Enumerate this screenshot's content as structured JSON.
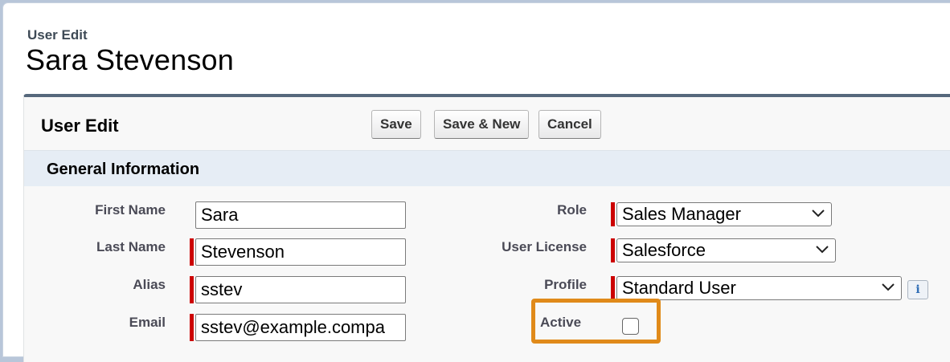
{
  "header": {
    "object_type": "User Edit",
    "record_name": "Sara Stevenson"
  },
  "block": {
    "title": "User Edit",
    "buttons": {
      "save": "Save",
      "save_new": "Save & New",
      "cancel": "Cancel"
    }
  },
  "section": {
    "title": "General Information"
  },
  "fields_left": {
    "first_name": {
      "label": "First Name",
      "value": "Sara"
    },
    "last_name": {
      "label": "Last Name",
      "value": "Stevenson"
    },
    "alias": {
      "label": "Alias",
      "value": "sstev"
    },
    "email": {
      "label": "Email",
      "value": "sstev@example.compa"
    }
  },
  "fields_right": {
    "role": {
      "label": "Role",
      "value": "Sales Manager"
    },
    "user_license": {
      "label": "User License",
      "value": "Salesforce"
    },
    "profile": {
      "label": "Profile",
      "value": "Standard User",
      "info_icon": "info-icon",
      "info_glyph": "i"
    },
    "active": {
      "label": "Active",
      "checked": false
    }
  },
  "colors": {
    "required_bar": "#cc0000",
    "highlight": "#e08a1a",
    "section_bg": "#e6edf5",
    "block_border": "#56687c"
  }
}
